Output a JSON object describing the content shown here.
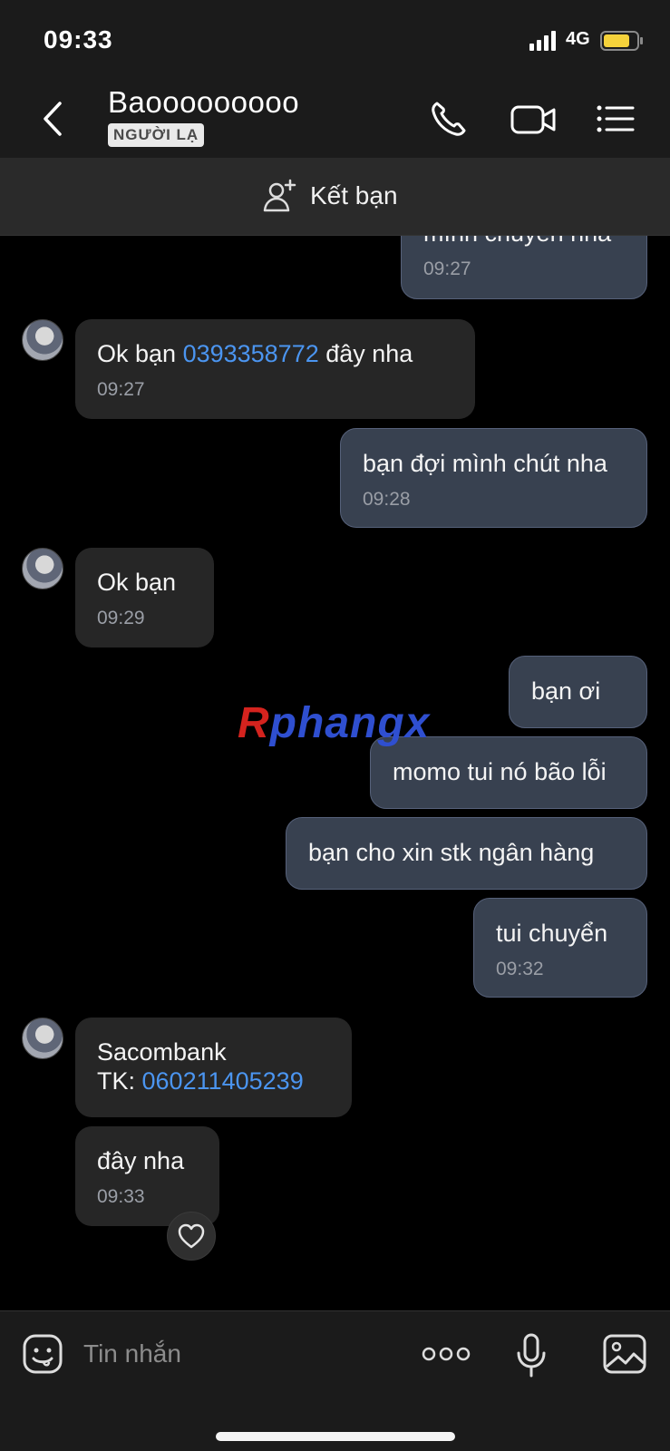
{
  "status_bar": {
    "time": "09:33",
    "network": "4G"
  },
  "header": {
    "contact_name": "Baooooooooo",
    "badge": "NGƯỜI LẠ"
  },
  "add_friend": {
    "label": "Kết bạn"
  },
  "watermark": {
    "first": "R",
    "rest": "phangx"
  },
  "messages": {
    "m0": {
      "text": "mình chuyển nha",
      "time": "09:27"
    },
    "m1": {
      "prefix": "Ok bạn ",
      "phone": "0393358772",
      "suffix": " đây nha",
      "time": "09:27"
    },
    "m2": {
      "text": "bạn đợi mình chút nha",
      "time": "09:28"
    },
    "m3": {
      "text": "Ok bạn",
      "time": "09:29"
    },
    "m4": {
      "text": "bạn ơi"
    },
    "m5": {
      "text": "momo tui nó bão lỗi"
    },
    "m6": {
      "text": "bạn cho xin stk ngân hàng"
    },
    "m7": {
      "text": "tui chuyển",
      "time": "09:32"
    },
    "m8": {
      "line1": "Sacombank",
      "tk_label": "TK: ",
      "account": "060211405239"
    },
    "m9": {
      "text": "đây nha",
      "time": "09:33"
    }
  },
  "composer": {
    "placeholder": "Tin nhắn"
  },
  "icons": {
    "back": "chevron-left-icon",
    "call": "phone-icon",
    "video": "video-icon",
    "menu": "list-icon",
    "add_friend": "add-user-icon",
    "emoji": "emoji-icon",
    "more": "more-icon",
    "mic": "microphone-icon",
    "image": "image-icon",
    "heart": "heart-icon"
  },
  "colors": {
    "link": "#4b95f0",
    "outgoing_bubble": "#384150",
    "incoming_bubble": "#262626",
    "battery": "#f5d23b"
  }
}
